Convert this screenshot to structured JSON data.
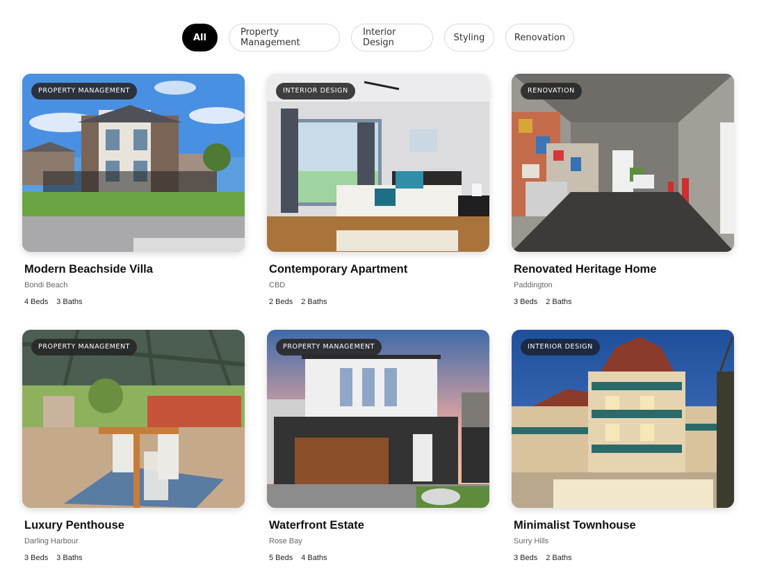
{
  "filters": [
    "All",
    "Property Management",
    "Interior Design",
    "Styling",
    "Renovation"
  ],
  "active_filter": "All",
  "cards": [
    {
      "tag": "Property Management",
      "title": "Modern Beachside Villa",
      "location": "Bondi Beach",
      "beds": "4 Beds",
      "baths": "3 Baths"
    },
    {
      "tag": "Interior Design",
      "title": "Contemporary Apartment",
      "location": "CBD",
      "beds": "2 Beds",
      "baths": "2 Baths"
    },
    {
      "tag": "Renovation",
      "title": "Renovated Heritage Home",
      "location": "Paddington",
      "beds": "3 Beds",
      "baths": "2 Baths"
    },
    {
      "tag": "Property Management",
      "title": "Luxury Penthouse",
      "location": "Darling Harbour",
      "beds": "3 Beds",
      "baths": "3 Baths"
    },
    {
      "tag": "Property Management",
      "title": "Waterfront Estate",
      "location": "Rose Bay",
      "beds": "5 Beds",
      "baths": "4 Baths"
    },
    {
      "tag": "Interior Design",
      "title": "Minimalist Townhouse",
      "location": "Surry Hills",
      "beds": "3 Beds",
      "baths": "2 Baths"
    }
  ]
}
